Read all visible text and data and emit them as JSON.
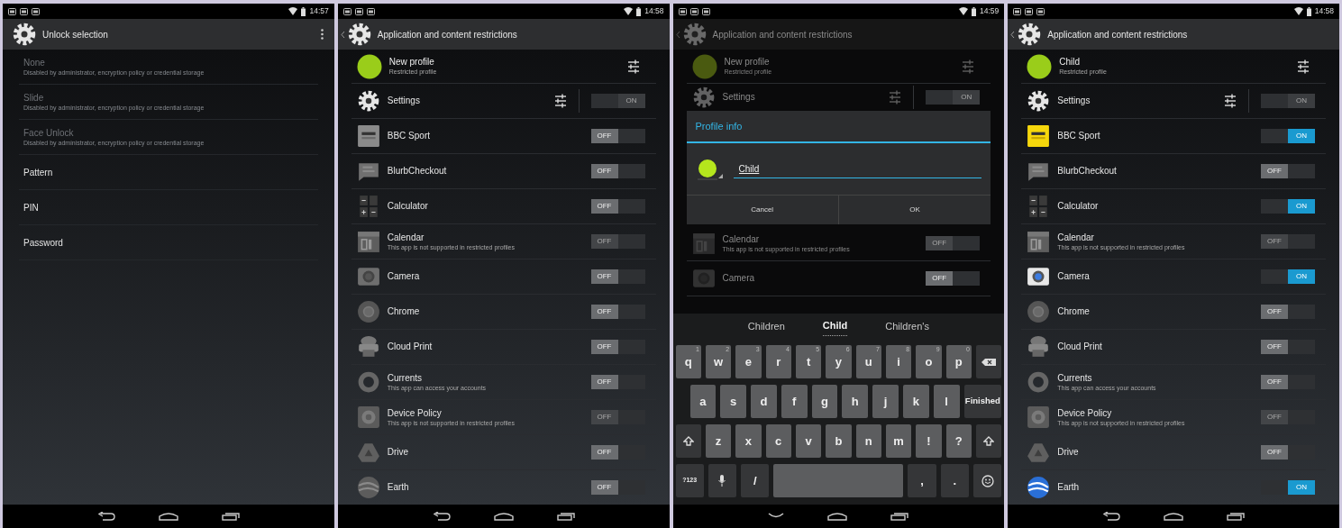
{
  "screens": [
    {
      "kind": "unlock",
      "time": "14:57",
      "title": "Unlock selection",
      "options": [
        {
          "label": "None",
          "summary": "Disabled by administrator, encryption policy or credential storage",
          "disabled": true
        },
        {
          "label": "Slide",
          "summary": "Disabled by administrator, encryption policy or credential storage",
          "disabled": true
        },
        {
          "label": "Face Unlock",
          "summary": "Disabled by administrator, encryption policy or credential storage",
          "disabled": true
        },
        {
          "label": "Pattern",
          "disabled": false
        },
        {
          "label": "PIN",
          "disabled": false
        },
        {
          "label": "Password",
          "disabled": false
        }
      ]
    },
    {
      "kind": "restrictions",
      "time": "14:58",
      "title": "Application and content restrictions",
      "profile": {
        "name": "New profile",
        "subtitle": "Restricted profile"
      },
      "rows": [
        {
          "kind": "settings",
          "name": "Settings",
          "toggle": {
            "label": "ON",
            "on": true,
            "disabled": true
          }
        },
        {
          "kind": "app",
          "name": "BBC Sport",
          "toggle": {
            "label": "OFF",
            "on": false,
            "disabled": false
          }
        },
        {
          "kind": "app",
          "name": "BlurbCheckout",
          "toggle": {
            "label": "OFF",
            "on": false,
            "disabled": false
          }
        },
        {
          "kind": "app",
          "name": "Calculator",
          "toggle": {
            "label": "OFF",
            "on": false,
            "disabled": false
          }
        },
        {
          "kind": "app",
          "name": "Calendar",
          "subtitle": "This app is not supported in restricted profiles",
          "toggle": {
            "label": "OFF",
            "on": false,
            "disabled": true
          }
        },
        {
          "kind": "app",
          "name": "Camera",
          "toggle": {
            "label": "OFF",
            "on": false,
            "disabled": false
          }
        },
        {
          "kind": "app",
          "name": "Chrome",
          "toggle": {
            "label": "OFF",
            "on": false,
            "disabled": false
          }
        },
        {
          "kind": "app",
          "name": "Cloud Print",
          "toggle": {
            "label": "OFF",
            "on": false,
            "disabled": false
          }
        },
        {
          "kind": "app",
          "name": "Currents",
          "subtitle": "This app can access your accounts",
          "toggle": {
            "label": "OFF",
            "on": false,
            "disabled": false
          }
        },
        {
          "kind": "app",
          "name": "Device Policy",
          "subtitle": "This app is not supported in restricted profiles",
          "toggle": {
            "label": "OFF",
            "on": false,
            "disabled": true
          }
        },
        {
          "kind": "app",
          "name": "Drive",
          "toggle": {
            "label": "OFF",
            "on": false,
            "disabled": false
          }
        },
        {
          "kind": "app",
          "name": "Earth",
          "toggle": {
            "label": "OFF",
            "on": false,
            "disabled": false
          }
        }
      ]
    },
    {
      "kind": "dialog",
      "time": "14:59",
      "title": "Application and content restrictions",
      "profile": {
        "name": "New profile",
        "subtitle": "Restricted profile"
      },
      "rows_above": [
        {
          "kind": "settings",
          "name": "Settings",
          "toggle": {
            "label": "ON",
            "on": true,
            "disabled": true
          }
        }
      ],
      "dialog": {
        "title": "Profile info",
        "value": "Child",
        "buttons": [
          "Cancel",
          "OK"
        ]
      },
      "rows_below": [
        {
          "name": "Calendar",
          "subtitle": "This app is not supported in restricted profiles",
          "toggle": {
            "label": "OFF",
            "on": false,
            "disabled": true
          }
        },
        {
          "name": "Camera",
          "toggle": {
            "label": "OFF",
            "on": false,
            "disabled": false
          }
        }
      ],
      "keyboard": {
        "suggestions": [
          {
            "text": "Children",
            "selected": false
          },
          {
            "text": "Child",
            "selected": true
          },
          {
            "text": "Children's",
            "selected": false
          }
        ],
        "rows": [
          [
            {
              "kind": "char",
              "label": "q",
              "hint": "1"
            },
            {
              "kind": "char",
              "label": "w",
              "hint": "2"
            },
            {
              "kind": "char",
              "label": "e",
              "hint": "3"
            },
            {
              "kind": "char",
              "label": "r",
              "hint": "4"
            },
            {
              "kind": "char",
              "label": "t",
              "hint": "5"
            },
            {
              "kind": "char",
              "label": "y",
              "hint": "6"
            },
            {
              "kind": "char",
              "label": "u",
              "hint": "7"
            },
            {
              "kind": "char",
              "label": "i",
              "hint": "8"
            },
            {
              "kind": "char",
              "label": "o",
              "hint": "9"
            },
            {
              "kind": "char",
              "label": "p",
              "hint": "0"
            },
            {
              "kind": "backspace"
            }
          ],
          [
            {
              "kind": "char",
              "label": "a"
            },
            {
              "kind": "char",
              "label": "s"
            },
            {
              "kind": "char",
              "label": "d"
            },
            {
              "kind": "char",
              "label": "f"
            },
            {
              "kind": "char",
              "label": "g"
            },
            {
              "kind": "char",
              "label": "h"
            },
            {
              "kind": "char",
              "label": "j"
            },
            {
              "kind": "char",
              "label": "k"
            },
            {
              "kind": "char",
              "label": "l"
            },
            {
              "kind": "action",
              "label": "Finished"
            }
          ],
          [
            {
              "kind": "shift"
            },
            {
              "kind": "char",
              "label": "z"
            },
            {
              "kind": "char",
              "label": "x"
            },
            {
              "kind": "char",
              "label": "c"
            },
            {
              "kind": "char",
              "label": "v"
            },
            {
              "kind": "char",
              "label": "b"
            },
            {
              "kind": "char",
              "label": "n"
            },
            {
              "kind": "char",
              "label": "m"
            },
            {
              "kind": "char",
              "label": "!"
            },
            {
              "kind": "char",
              "label": "?"
            },
            {
              "kind": "shift"
            }
          ],
          [
            {
              "kind": "symbol",
              "label": "?123"
            },
            {
              "kind": "mic"
            },
            {
              "kind": "symbol",
              "label": "/"
            },
            {
              "kind": "space"
            },
            {
              "kind": "symbol",
              "label": ","
            },
            {
              "kind": "symbol",
              "label": "."
            },
            {
              "kind": "emoji"
            }
          ]
        ]
      }
    },
    {
      "kind": "restrictions",
      "time": "14:58",
      "title": "Application and content restrictions",
      "profile": {
        "name": "Child",
        "subtitle": "Restricted profile"
      },
      "rows": [
        {
          "kind": "settings",
          "name": "Settings",
          "toggle": {
            "label": "ON",
            "on": true,
            "disabled": true
          }
        },
        {
          "kind": "app",
          "name": "BBC Sport",
          "toggle": {
            "label": "ON",
            "on": true,
            "disabled": false
          }
        },
        {
          "kind": "app",
          "name": "BlurbCheckout",
          "toggle": {
            "label": "OFF",
            "on": false,
            "disabled": false
          }
        },
        {
          "kind": "app",
          "name": "Calculator",
          "toggle": {
            "label": "ON",
            "on": true,
            "disabled": false
          }
        },
        {
          "kind": "app",
          "name": "Calendar",
          "subtitle": "This app is not supported in restricted profiles",
          "toggle": {
            "label": "OFF",
            "on": false,
            "disabled": true
          }
        },
        {
          "kind": "app",
          "name": "Camera",
          "toggle": {
            "label": "ON",
            "on": true,
            "disabled": false
          }
        },
        {
          "kind": "app",
          "name": "Chrome",
          "toggle": {
            "label": "OFF",
            "on": false,
            "disabled": false
          }
        },
        {
          "kind": "app",
          "name": "Cloud Print",
          "toggle": {
            "label": "OFF",
            "on": false,
            "disabled": false
          }
        },
        {
          "kind": "app",
          "name": "Currents",
          "subtitle": "This app can access your accounts",
          "toggle": {
            "label": "OFF",
            "on": false,
            "disabled": false
          }
        },
        {
          "kind": "app",
          "name": "Device Policy",
          "subtitle": "This app is not supported in restricted profiles",
          "toggle": {
            "label": "OFF",
            "on": false,
            "disabled": true
          }
        },
        {
          "kind": "app",
          "name": "Drive",
          "toggle": {
            "label": "OFF",
            "on": false,
            "disabled": false
          }
        },
        {
          "kind": "app",
          "name": "Earth",
          "toggle": {
            "label": "ON",
            "on": true,
            "disabled": false
          }
        }
      ]
    }
  ]
}
